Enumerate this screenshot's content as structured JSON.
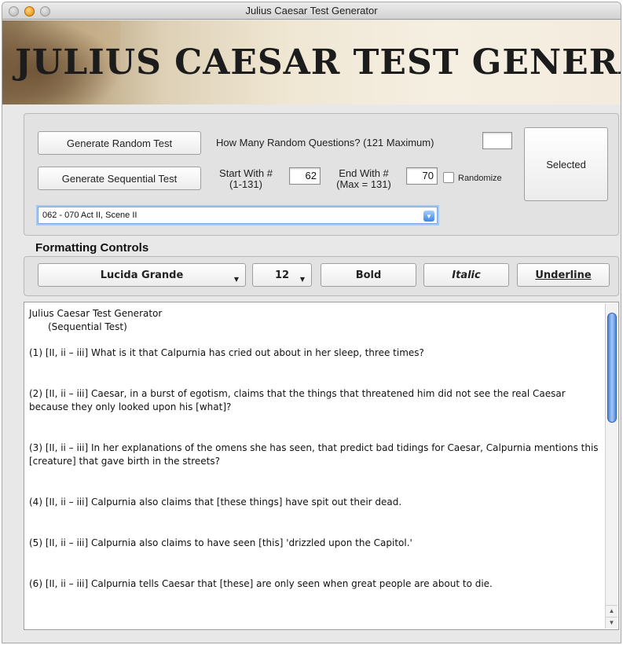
{
  "window": {
    "title": "Julius Caesar Test Generator"
  },
  "banner": {
    "title": "JULIUS CAESAR TEST GENERATOR"
  },
  "controls": {
    "random_button": "Generate Random Test",
    "random_prompt": "How Many Random Questions? (121 Maximum)",
    "random_count": "",
    "selected_button": "Selected",
    "sequential_button": "Generate Sequential Test",
    "start_label_1": "Start With #",
    "start_label_2": "(1-131)",
    "start_value": "62",
    "end_label_1": "End With #",
    "end_label_2": "(Max = 131)",
    "end_value": "70",
    "randomize_label": "Randomize",
    "randomize_checked": false,
    "range_selection": "062 - 070  Act II, Scene II"
  },
  "formatting": {
    "title": "Formatting Controls",
    "font": "Lucida Grande",
    "size": "12",
    "bold": "Bold",
    "italic": "Italic",
    "underline": "Underline"
  },
  "document": {
    "title": "Julius Caesar Test Generator",
    "subtitle": "(Sequential Test)",
    "questions": [
      "(1)  [II, ii – iii] What is it that Calpurnia has cried out about in her sleep, three times?",
      "(2)  [II, ii – iii] Caesar, in a burst of egotism, claims that the things that threatened him did not see the real Caesar because they only looked upon his [what]?",
      "(3)  [II, ii – iii] In her explanations of the omens she has seen, that predict bad tidings for Caesar, Calpurnia mentions this [creature] that gave birth in the streets?",
      "(4)  [II, ii – iii] Calpurnia also claims that [these things] have spit out their dead.",
      "(5)  [II, ii – iii] Calpurnia also claims to have seen [this] 'drizzled upon the Capitol.'",
      "(6)  [II, ii – iii] Calpurnia tells Caesar that [these] are only seen when great people are about to die."
    ]
  }
}
